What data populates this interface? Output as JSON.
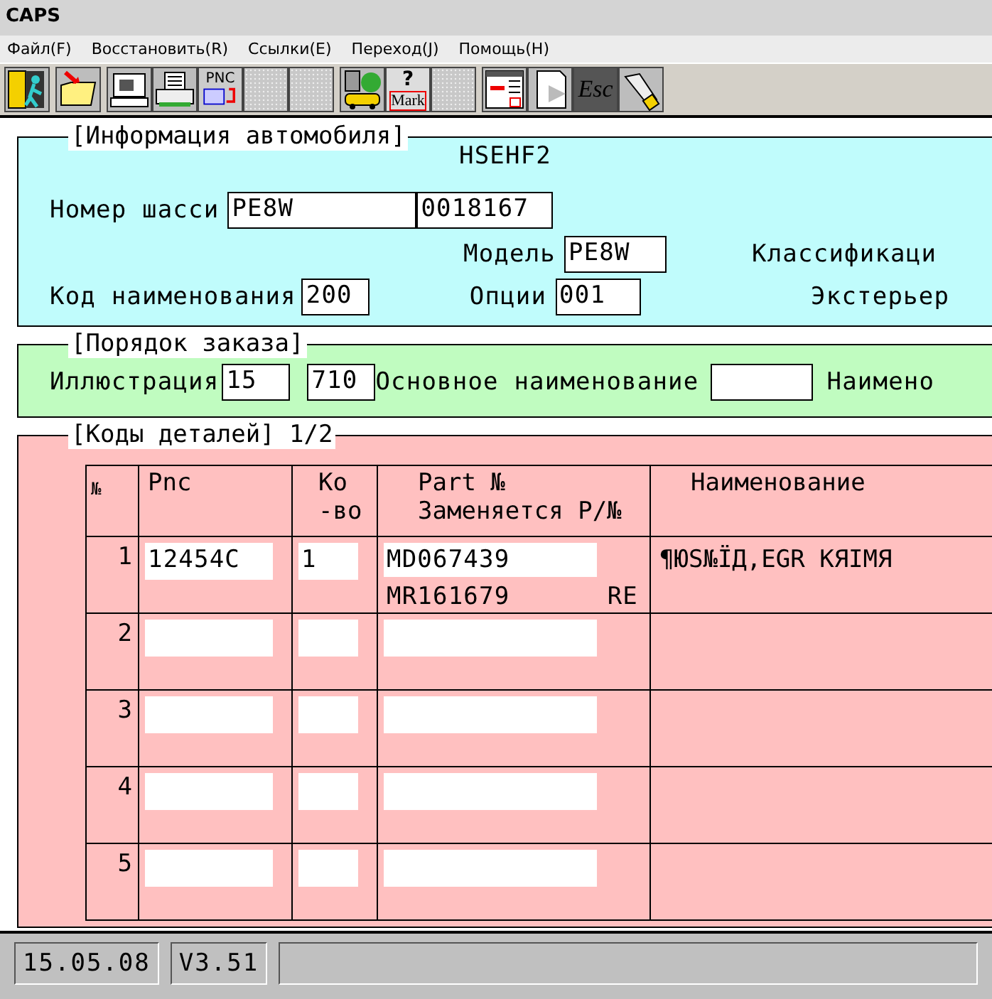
{
  "window": {
    "title": "CAPS"
  },
  "menu": [
    "Файл(F)",
    "Восстановить(R)",
    "Ссылки(E)",
    "Переход(J)",
    "Помощь(H)"
  ],
  "toolbar": [
    {
      "kind": "exit"
    },
    {
      "kind": "folder"
    },
    {
      "kind": "computer"
    },
    {
      "kind": "printer"
    },
    {
      "kind": "pnc",
      "text": "PNC"
    },
    {
      "kind": "blank"
    },
    {
      "kind": "blank"
    },
    {
      "kind": "parts-help"
    },
    {
      "kind": "mark",
      "symbol": "?",
      "text": "Mark"
    },
    {
      "kind": "blank"
    },
    {
      "kind": "window"
    },
    {
      "kind": "document"
    },
    {
      "kind": "esc",
      "text": "Esc"
    },
    {
      "kind": "flashlight"
    }
  ],
  "vehicle_info": {
    "title": "[Информация автомобиля]",
    "code": "HSEHF2",
    "chassis_label": "Номер шасси",
    "chassis_values": [
      "PE8W",
      "0018167"
    ],
    "model_label": "Модель",
    "model": "PE8W",
    "classification_label": "Классификаци",
    "name_code_label": "Код наименования",
    "name_code": "200",
    "options_label": "Опции",
    "options": "001",
    "exterior_label": "Экстерьер"
  },
  "order": {
    "title": "[Порядок заказа]",
    "illustration_label": "Иллюстрация",
    "illustration_values": [
      "15",
      "710"
    ],
    "main_name_label": "Основное наименование",
    "name_label": "Наимено"
  },
  "parts": {
    "title": "[Коды деталей] 1/2",
    "columns": [
      [
        "№"
      ],
      [
        "Pnc"
      ],
      [
        "Ко",
        "-во"
      ],
      [
        "Part №",
        "Заменяется P/№"
      ],
      [
        "Наименование"
      ]
    ],
    "rows": [
      {
        "number": "1",
        "pnc": "12454C",
        "qty": "1",
        "part_no": "MD067439",
        "replaced_by": "MR161679",
        "replaced_mark": "RE",
        "name": "¶ЮS№ЇД,EGR KЯIMЯ"
      },
      {
        "number": "2"
      },
      {
        "number": "3"
      },
      {
        "number": "4"
      },
      {
        "number": "5"
      }
    ]
  },
  "status_bar": {
    "date": "15.05.08",
    "version": "V3.51"
  }
}
